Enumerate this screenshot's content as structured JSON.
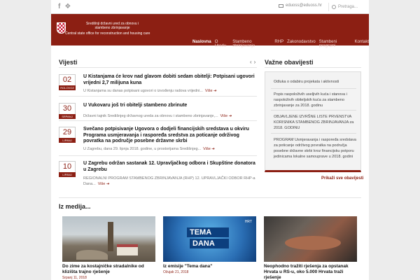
{
  "topbar": {
    "email": "eduoss@eduoss.hr",
    "search_placeholder": "Pretraga..."
  },
  "header": {
    "org_name_line": "Središnji državni ured za obnovu i stambeno zbrinjavanje",
    "org_name_en": "Central state office for reconstruction and housing care",
    "nav": [
      "Naslovna",
      "O Uredu",
      "Stambeno zbrinjavanje",
      "RHP",
      "Zakonodavstvo",
      "Stambeni programi",
      "Kontakt"
    ],
    "accent": "#8c1f13"
  },
  "news": {
    "heading": "Vijesti",
    "more_label": "Više",
    "items": [
      {
        "day": "02",
        "month": "ROLOVOZ",
        "title": "U Kistanjama će krov nad glavom dobiti sedam obitelji: Potpisani ugovori vrijedni 2,7 milijuna kuna",
        "excerpt": "U Kistanjama su danas potpisani ugovori o izvođenju radova vrijedni..."
      },
      {
        "day": "30",
        "month": "SRPANJ",
        "title": "U Vukovaru još tri obitelji stambeno zbrinute",
        "excerpt": "Državni tajnik Središnjeg državnog ureda za obnovu i stambeno zbrinjavanje,..."
      },
      {
        "day": "29",
        "month": "LIPANJ",
        "title": "Svečano potpisivanje Ugovora o dodjeli financijskih sredstava u okviru Programa usmjeravanja i raspoređa sredstva za poticanje održivog povratka na područje posebne državne skrbi",
        "excerpt": "U Zagrebu, dana 29. lipnja 2018. godine, u prostorijama Središnjeg..."
      },
      {
        "day": "10",
        "month": "LIPANJ",
        "title": "U Zagrebu održan sastanak 12. Upravljačkog odbora i Skupštine donatora u Zagrebu",
        "excerpt": "REGIONALNI PROGRAM STAMBENOG ZBRINJAVANJA (RHP) 12. UPRAVLJAČKI ODBOR RHP-a  Dana..."
      }
    ]
  },
  "notices": {
    "heading": "Važne obavijesti",
    "items": [
      "Odluka o odabiru projekata i aktivnosti",
      "Popis raspoloživih useljivih kuća i stanova i raspoloživih obiteljskih kuća za stambeno zbrinjavanje za 2018. godinu",
      "OBJAVLJENE IZVRŠNE LISTE PRVENSTVA KORISNIKA STAMBENOG ZBRINJAVANJA za 2018. GODINU",
      "PROGRAM Usmjeravanja i raspoređa sredstava za poticanje održivog povratka na područja posebne državne skrbi kroz financijsku potporu jedinicama lokalne samouprave u 2018. godini"
    ],
    "all_label": "Prikaži sve obavijesti"
  },
  "media": {
    "heading": "Iz medija...",
    "items": [
      {
        "caption": "Do zime za kostajničke stradalnike od klizišta trajno rješenje",
        "date": "Srpanj 11, 2018"
      },
      {
        "caption": "Iz emisije \"Tema dana\"",
        "date": "Ožujak 21, 2018",
        "thumb_text_1": "TEMA",
        "thumb_text_2": "DANA",
        "thumb_logo": "HRT"
      },
      {
        "caption": "Neophodno tražiti rješenja za opstanak Hrvata u RS-u, oko 5.000 Hrvata traži rješenje",
        "date": ""
      }
    ]
  }
}
